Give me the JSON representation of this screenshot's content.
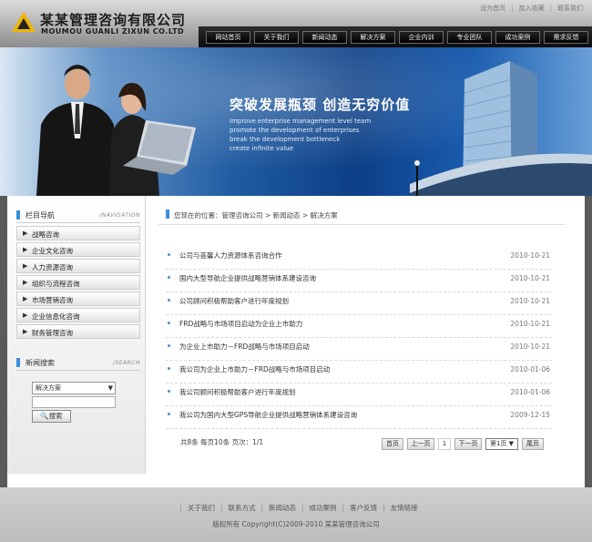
{
  "top_links": [
    "设为首页",
    "加入收藏",
    "联系我们"
  ],
  "logo": {
    "name_cn": "某某管理咨询有限公司",
    "name_en": "MOUMOU GUANLI ZIXUN CO.LTD"
  },
  "nav": [
    "网站首页",
    "关于我们",
    "新闻动态",
    "解决方案",
    "企业内训",
    "专业团队",
    "成功案例",
    "需求反馈"
  ],
  "banner": {
    "title": "突破发展瓶颈 创造无穷价值",
    "lines": [
      "Improve enterprise management level team",
      "promote the development of enterprises",
      "break the development bottleneck",
      "create infinite value"
    ]
  },
  "sidebar": {
    "categories_title": "栏目导航",
    "categories_title_en": "/NAVIGATION",
    "categories": [
      "战略咨询",
      "企业文化咨询",
      "人力资源咨询",
      "组织与流程咨询",
      "市场营销咨询",
      "企业信息化咨询",
      "财务管理咨询"
    ],
    "search_title": "新闻搜索",
    "search_title_en": "/SEARCH",
    "search_select_value": "解决方案",
    "search_button": "搜索"
  },
  "breadcrumb": "您现在的位置：管理咨询公司 > 新闻动态 > 解决方案",
  "news": [
    {
      "title": "公司与荟馨人力资源体系咨询合作",
      "date": "2010-10-21"
    },
    {
      "title": "国内大型导航企业提供战略营销体系建设咨询",
      "date": "2010-10-21"
    },
    {
      "title": "公司顾问积极帮助客户进行年度规划",
      "date": "2010-10-21"
    },
    {
      "title": "FRD战略与市场项目启动为企业上市助力",
      "date": "2010-10-21"
    },
    {
      "title": "为企业上市助力－FRD战略与市场项目启动",
      "date": "2010-10-21"
    },
    {
      "title": "我公司为企业上市助力－FRD战略与市场项目启动",
      "date": "2010-01-06"
    },
    {
      "title": "我公司顾问积极帮助客户进行年度规划",
      "date": "2010-01-06"
    },
    {
      "title": "我公司为国内大型GPS导航企业提供战略营销体系建设咨询",
      "date": "2009-12-15"
    }
  ],
  "pager": {
    "info": "共8条  每页10条  页次：1/1",
    "first": "首页",
    "prev": "上一页",
    "current": "1",
    "next": "下一页",
    "select_value": "第1页",
    "last": "尾页"
  },
  "footer": {
    "links": [
      "关于我们",
      "联系方式",
      "新闻动态",
      "成功案例",
      "客户反馈",
      "友情链接"
    ],
    "copyright": "版权所有  Copyright(C)2009-2010 某某管理咨询公司"
  },
  "colors": {
    "accent_blue": "#3a8fd9",
    "nav_bg": "#111111",
    "banner_blue": "#0c3f86"
  }
}
